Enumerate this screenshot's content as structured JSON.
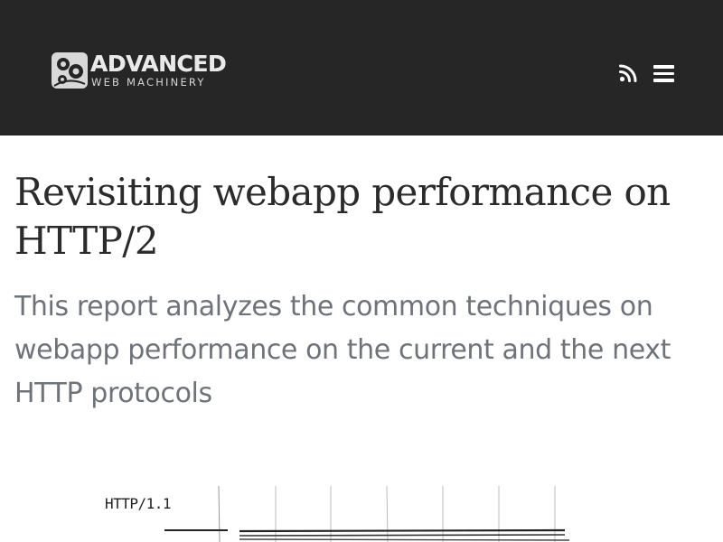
{
  "header": {
    "logo": {
      "line1": "ADVANCED",
      "line2": "WEB MACHINERY"
    },
    "rss_icon": "rss-icon",
    "menu_icon": "hamburger-menu-icon"
  },
  "article": {
    "title": "Revisiting webapp performance on HTTP/2",
    "subtitle": "This report analyzes the common techniques on webapp performance on the current and the next HTTP protocols"
  },
  "figure": {
    "label": "HTTP/1.1"
  },
  "colors": {
    "header_bg": "#262626",
    "title": "#2b2b2b",
    "subtitle": "#6e737a"
  }
}
